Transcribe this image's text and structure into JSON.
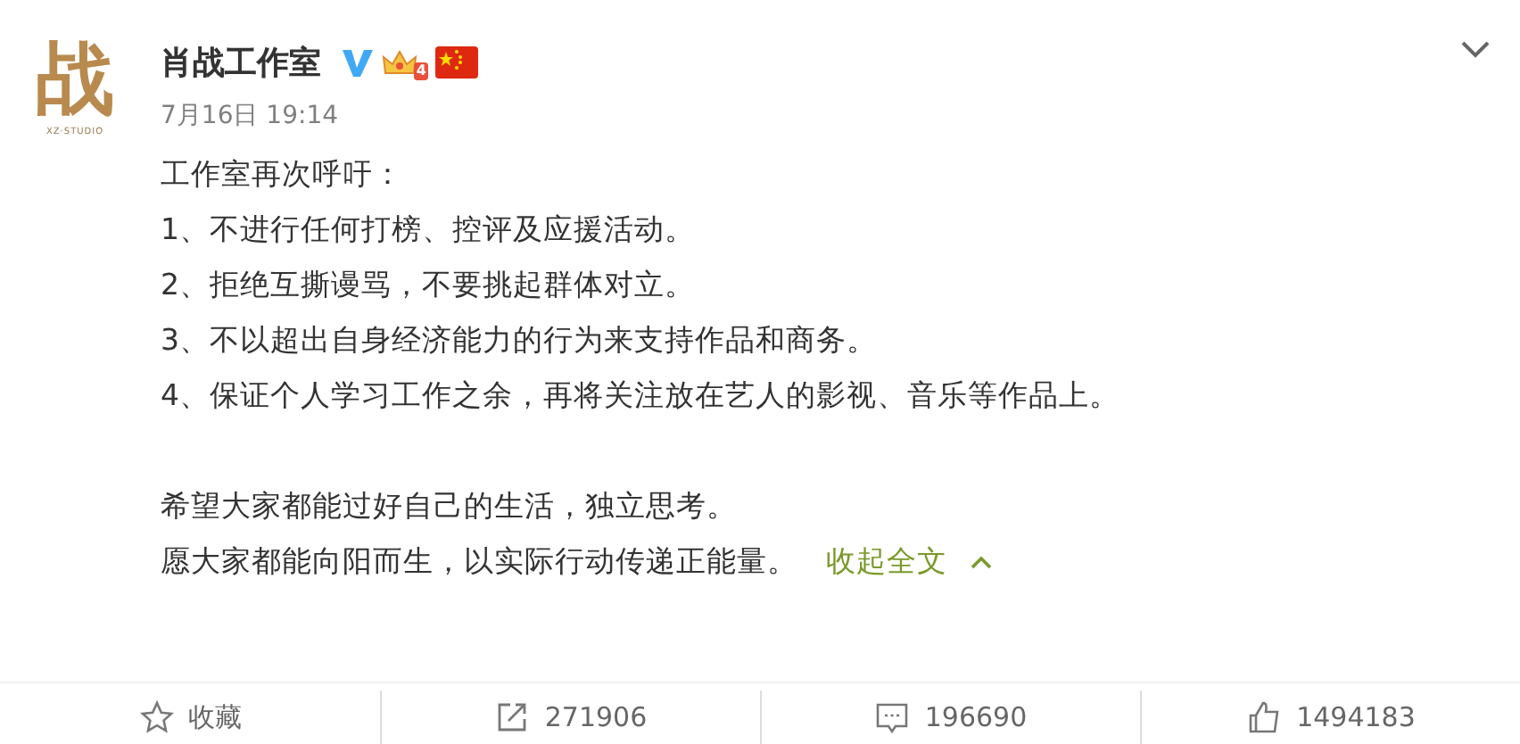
{
  "author": {
    "avatar_text": "战",
    "avatar_caption": "XZ·STUDIO",
    "name": "肖战工作室",
    "level": "4"
  },
  "time": "7月16日 19:14",
  "paragraphs": [
    [
      "工作室再次呼吁：",
      "1、不进行任何打榜、控评及应援活动。",
      "2、拒绝互撕谩骂，不要挑起群体对立。",
      "3、不以超出自身经济能力的行为来支持作品和商务。",
      "4、保证个人学习工作之余，再将关注放在艺人的影视、音乐等作品上。"
    ],
    [
      "希望大家都能过好自己的生活，独立思考。",
      "愿大家都能向阳而生，以实际行动传递正能量。"
    ]
  ],
  "collapse_link": "收起全文",
  "actions": [
    {
      "kind": "favorite",
      "label": "收藏"
    },
    {
      "kind": "repost",
      "label": "271906"
    },
    {
      "kind": "comment",
      "label": "196690"
    },
    {
      "kind": "like",
      "label": "1494183"
    }
  ]
}
